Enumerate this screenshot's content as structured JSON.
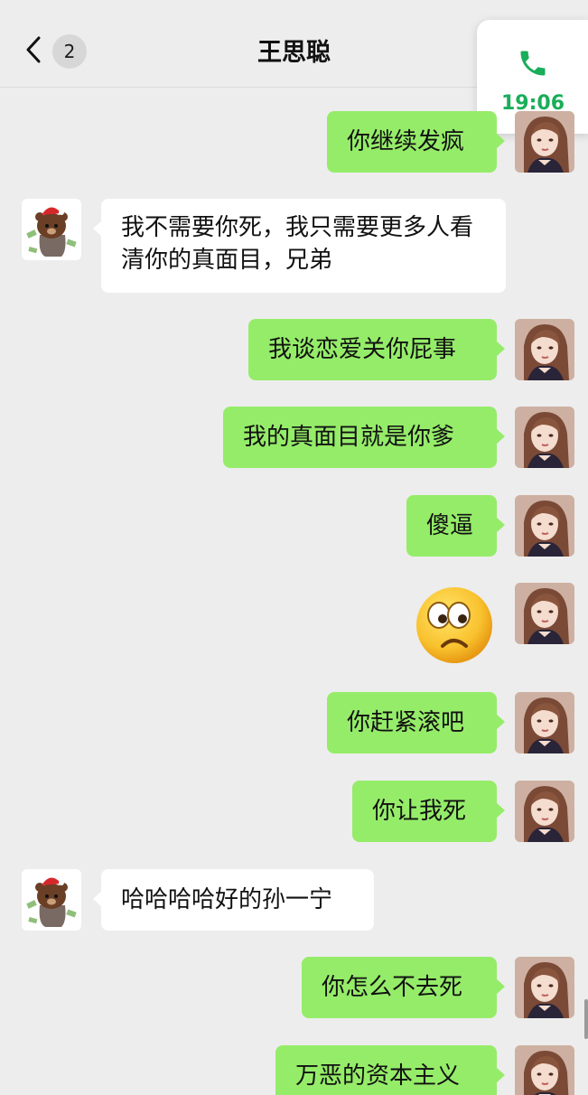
{
  "header": {
    "title": "王思聪",
    "back_icon": "chevron-left-icon",
    "unread_count": "2"
  },
  "call_widget": {
    "icon": "phone-icon",
    "time": "19:06",
    "accent": "#1aad5a"
  },
  "colors": {
    "sent_bubble": "#95ec69",
    "received_bubble": "#ffffff",
    "background": "#ededed"
  },
  "messages": [
    {
      "side": "sent",
      "text": "你继续发疯"
    },
    {
      "side": "received",
      "text": "我不需要你死，我只需要更多人看清你的真面目，兄弟"
    },
    {
      "side": "sent",
      "text": "我谈恋爱关你屁事"
    },
    {
      "side": "sent",
      "text": "我的真面目就是你爹"
    },
    {
      "side": "sent",
      "text": "傻逼"
    },
    {
      "side": "sent",
      "sticker": "worried-face-emoji"
    },
    {
      "side": "sent",
      "text": "你赶紧滚吧"
    },
    {
      "side": "sent",
      "text": "你让我死"
    },
    {
      "side": "received",
      "text": "哈哈哈哈好的孙一宁"
    },
    {
      "side": "sent",
      "text": "你怎么不去死"
    },
    {
      "side": "sent",
      "text": "万恶的资本主义"
    }
  ]
}
